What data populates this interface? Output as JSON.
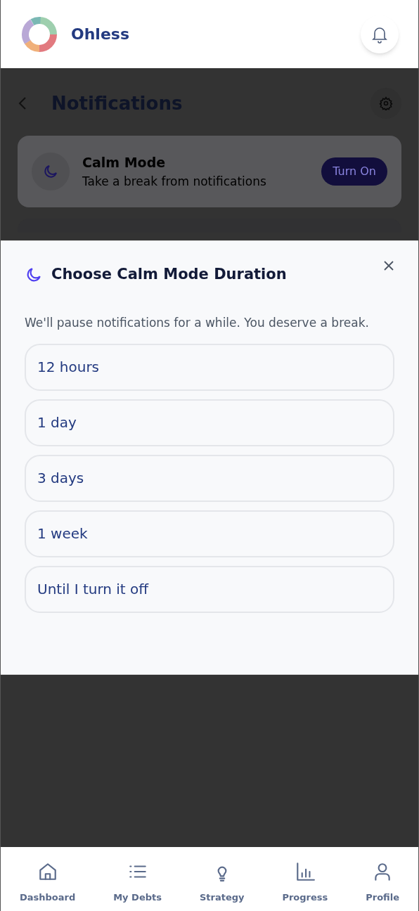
{
  "header": {
    "app_name": "Ohless"
  },
  "page": {
    "title": "Notifications",
    "calm_card": {
      "title": "Calm Mode",
      "subtitle": "Take a break from notifications",
      "button": "Turn On"
    }
  },
  "dialog": {
    "title": "Choose Calm Mode Duration",
    "message": "We'll pause notifications for a while. You deserve a break.",
    "options": [
      {
        "label": "12 hours"
      },
      {
        "label": "1 day"
      },
      {
        "label": "3 days"
      },
      {
        "label": "1 week"
      },
      {
        "label": "Until I turn it off"
      }
    ]
  },
  "bottom_nav": [
    {
      "label": "Dashboard"
    },
    {
      "label": "My Debts"
    },
    {
      "label": "Strategy"
    },
    {
      "label": "Progress"
    },
    {
      "label": "Profile"
    }
  ]
}
